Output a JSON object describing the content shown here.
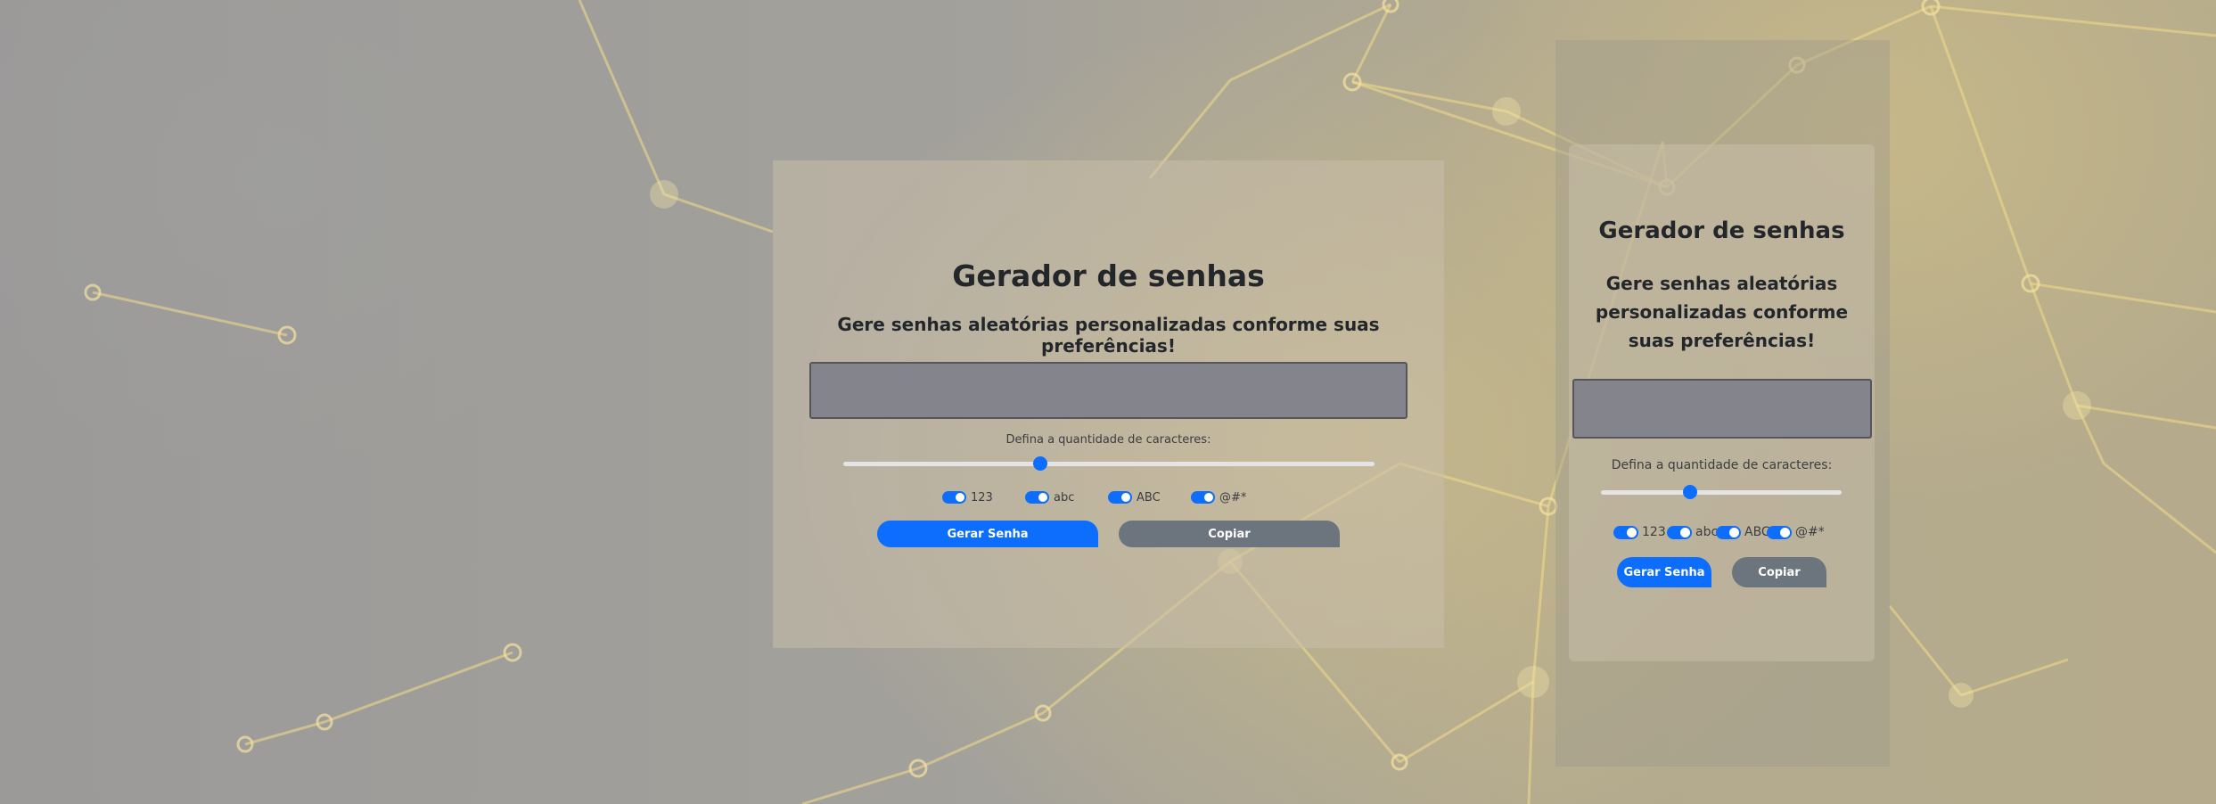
{
  "theme": {
    "primary": "#0d6efd",
    "secondary": "#6c757d",
    "input_bg": "#84848c",
    "text_dark": "#23262a"
  },
  "app": {
    "title": "Gerador de senhas",
    "subtitle": "Gere senhas aleatórias personalizadas conforme suas preferências!",
    "password": {
      "value": ""
    },
    "length": {
      "label": "Defina a quantidade de caracteres:",
      "level_fraction": 0.37
    },
    "options": [
      {
        "label": "123",
        "checked": true,
        "icon": "toggle-switch-icon"
      },
      {
        "label": "abc",
        "checked": true,
        "icon": "toggle-switch-icon"
      },
      {
        "label": "ABC",
        "checked": true,
        "icon": "toggle-switch-icon"
      },
      {
        "label": "@#*",
        "checked": true,
        "icon": "toggle-switch-icon"
      }
    ],
    "generate_label": "Gerar Senha",
    "copy_label": "Copiar"
  }
}
